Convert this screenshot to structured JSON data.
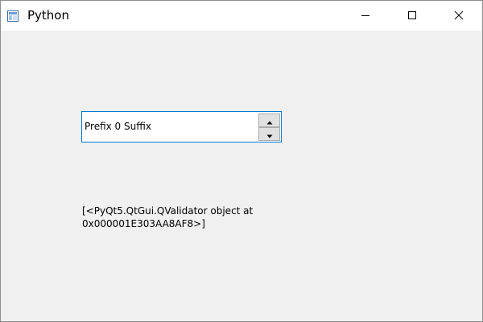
{
  "window": {
    "title": "Python",
    "app_icon": "qt-app-icon",
    "controls": {
      "minimize_icon": "minimize-icon",
      "maximize_icon": "maximize-icon",
      "close_icon": "close-icon"
    }
  },
  "spinbox": {
    "text": "Prefix 0 Suffix",
    "up_icon": "arrow-up-icon",
    "down_icon": "arrow-down-icon",
    "border_color": "#0078d7"
  },
  "label": {
    "line1": "[<PyQt5.QtGui.QValidator object at",
    "line2": "0x000001E303AA8AF8>]"
  }
}
